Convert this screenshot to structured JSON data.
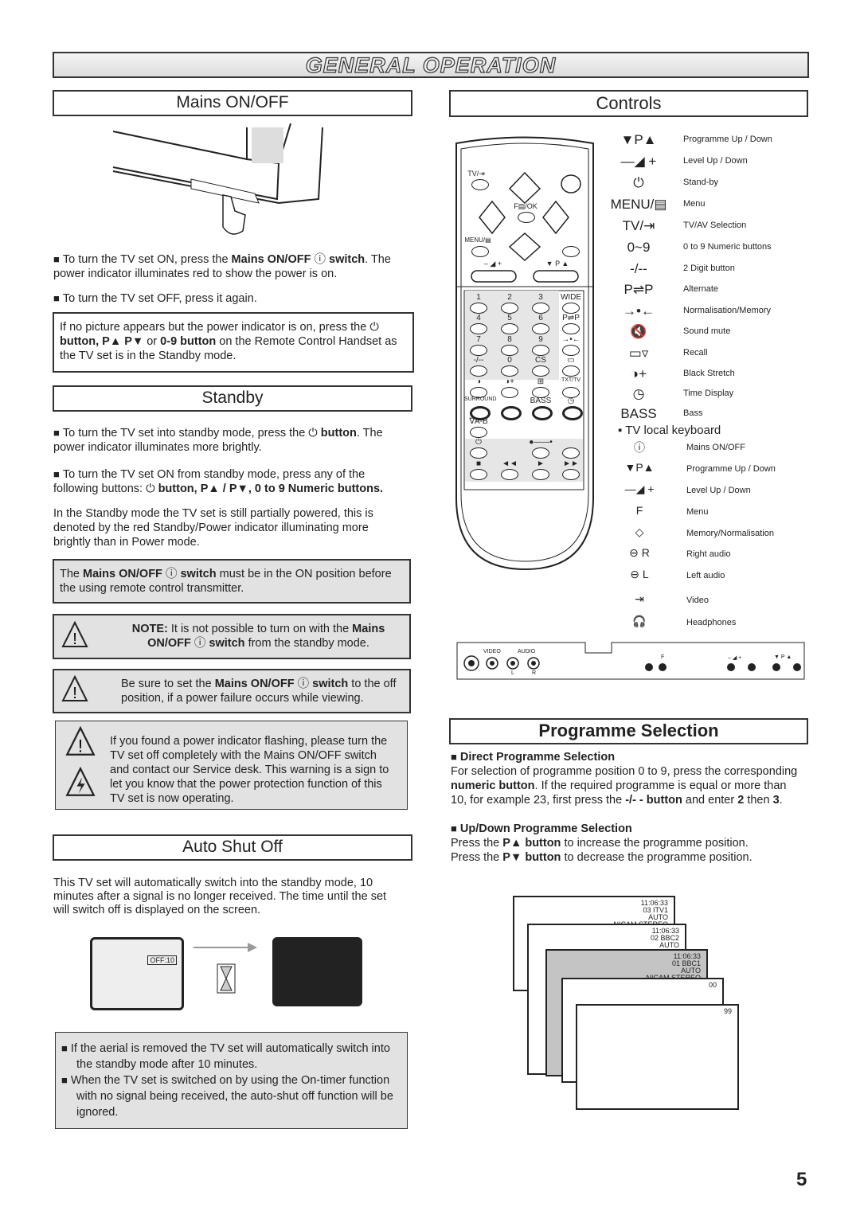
{
  "page_title": "GENERAL OPERATION",
  "page_number": "5",
  "mains": {
    "title": "Mains ON/OFF",
    "p1_a": "To turn the TV set ON, press the ",
    "p1_b": "Mains ON/OFF",
    "p1_c": " switch",
    "p1_d": ". The power indicator illuminates red to show the power is on.",
    "p2": "To turn the TV set OFF, press it again.",
    "box_a": "If no picture appears but the power indicator is on, press the ",
    "box_b": "button, P▲ P▼",
    "box_c": " or ",
    "box_d": "0-9 button",
    "box_e": " on the Remote Control Handset as the TV set is in the Standby mode."
  },
  "standby": {
    "title": "Standby",
    "p1_a": "To turn the TV set into standby mode, press the ",
    "p1_b": "button",
    "p1_c": ".  The power indicator illuminates more brightly.",
    "p2_a": "To turn the TV set ON from standby mode, press any of the following buttons: ",
    "p2_b": "button, P▲ / P▼, 0 to 9 Numeric buttons.",
    "p3": "In the Standby mode the TV set is still partially powered, this is denoted by the red Standby/Power indicator illuminating more brightly than in Power mode.",
    "box1_a": "The ",
    "box1_b": "Mains ON/OFF",
    "box1_c": " switch",
    "box1_d": " must be in the ON position before the using remote control transmitter.",
    "note_a": "NOTE:",
    "note_b": " It is not possible to turn on with the ",
    "note_c": "Mains ON/OFF",
    "note_d": " switch",
    "note_e": " from the standby mode.",
    "warn2_a": "Be sure to set the ",
    "warn2_b": "Mains ON/OFF",
    "warn2_c": " switch",
    "warn2_d": " to the off position, if a power failure occurs while viewing.",
    "warn3": "If you found a power indicator flashing, please turn the TV set off completely with the Mains ON/OFF switch and contact our Service desk. This warning is a sign to let you know that the power protection function of this TV set is now operating."
  },
  "auto_shut_off": {
    "title": "Auto Shut Off",
    "p1": "This TV set will automatically switch into the standby mode, 10 minutes after a signal is no longer received. The time until the set will switch off is displayed on the screen.",
    "osd": "OFF:10",
    "notes": [
      "If the aerial is removed the TV set will automatically switch into the standby mode after 10 minutes.",
      "When the TV set is switched on by using the On-timer function with no signal being received, the auto-shut off function will be ignored."
    ]
  },
  "controls": {
    "title": "Controls",
    "legend": [
      {
        "symbol": "▼P▲",
        "label": "Programme Up / Down"
      },
      {
        "symbol": "—◢ +",
        "label": "Level   Up / Down"
      },
      {
        "symbol": "⏻",
        "label": "Stand-by"
      },
      {
        "symbol": "MENU/▤",
        "label": "Menu"
      },
      {
        "symbol": "TV/⇥",
        "label": "TV/AV Selection"
      },
      {
        "symbol": "0~9",
        "label": "0 to 9 Numeric buttons"
      },
      {
        "symbol": "-/--",
        "label": "2 Digit button"
      },
      {
        "symbol": "P⇌P",
        "label": "Alternate"
      },
      {
        "symbol": "→•←",
        "label": "Normalisation/Memory"
      },
      {
        "symbol": "🔇",
        "label": "Sound mute"
      },
      {
        "symbol": "▭▿",
        "label": "Recall"
      },
      {
        "symbol": "◑+",
        "label": "Black Stretch"
      },
      {
        "symbol": "◷",
        "label": "Time Display"
      },
      {
        "symbol": "BASS",
        "label": "Bass"
      }
    ],
    "local_title": "TV local keyboard",
    "local": [
      {
        "symbol": "ⓘ",
        "label": "Mains ON/OFF"
      },
      {
        "symbol": "▼P▲",
        "label": "Programme Up / Down"
      },
      {
        "symbol": "—◢ +",
        "label": "Level Up / Down"
      },
      {
        "symbol": "F",
        "label": "Menu"
      },
      {
        "symbol": "◇",
        "label": "Memory/Normalisation"
      },
      {
        "symbol": "⊖ R",
        "label": "Right audio"
      },
      {
        "symbol": "⊖ L",
        "label": "Left audio"
      },
      {
        "symbol": "⇥",
        "label": "Video"
      },
      {
        "symbol": "🎧",
        "label": "Headphones"
      }
    ],
    "remote_top": [
      "TV/⇥",
      "F▤/OK",
      "MENU/▤",
      "– ◢ +",
      "▼ P ▲"
    ],
    "remote_keys": [
      "1",
      "2",
      "3",
      "WIDE",
      "4",
      "5",
      "6",
      "P⇌P",
      "7",
      "8",
      "9",
      "→•←",
      "-/--",
      "0",
      "CS",
      "▭",
      "◑",
      "◑+",
      "⊞",
      "TXT/TV",
      "SURROUND",
      "",
      "BASS",
      "◷",
      "∇A-B",
      "",
      "",
      "",
      "⏻",
      "",
      "●——•",
      "",
      "■",
      "◄◄",
      "►",
      "►►"
    ],
    "panel_labels": [
      "VIDEO",
      "AUDIO",
      "L",
      "R",
      "F",
      "– ◢ +",
      "▼ P ▲"
    ]
  },
  "programme": {
    "title": "Programme Selection",
    "h1": "Direct Programme Selection",
    "p1_a": "For selection of programme position 0 to 9, press the corresponding ",
    "p1_b": "numeric button",
    "p1_c": ".  If the required programme is equal or more than 10, for example 23, first press the ",
    "p1_d": "-/- - button",
    "p1_e": " and enter ",
    "p1_f": "2",
    "p1_g": " then ",
    "p1_h": "3",
    "h2": "Up/Down Programme Selection",
    "p2_a": "Press the ",
    "p2_b": "P▲ button",
    "p2_c": " to increase the programme position.",
    "p3_a": "Press the ",
    "p3_b": "P▼ button",
    "p3_c": " to decrease the programme position.",
    "screens": [
      {
        "lines": [
          "11:06:33",
          "03 ITV1",
          "AUTO",
          "NICAM STEREO"
        ]
      },
      {
        "lines": [
          "11:06:33",
          "02  BBC2",
          "AUTO"
        ]
      },
      {
        "lines": [
          "11:06:33",
          "01  BBC1",
          "AUTO",
          "NICAM STEREO"
        ]
      },
      {
        "lines": [
          "00"
        ]
      },
      {
        "lines": [
          "99"
        ]
      }
    ]
  }
}
